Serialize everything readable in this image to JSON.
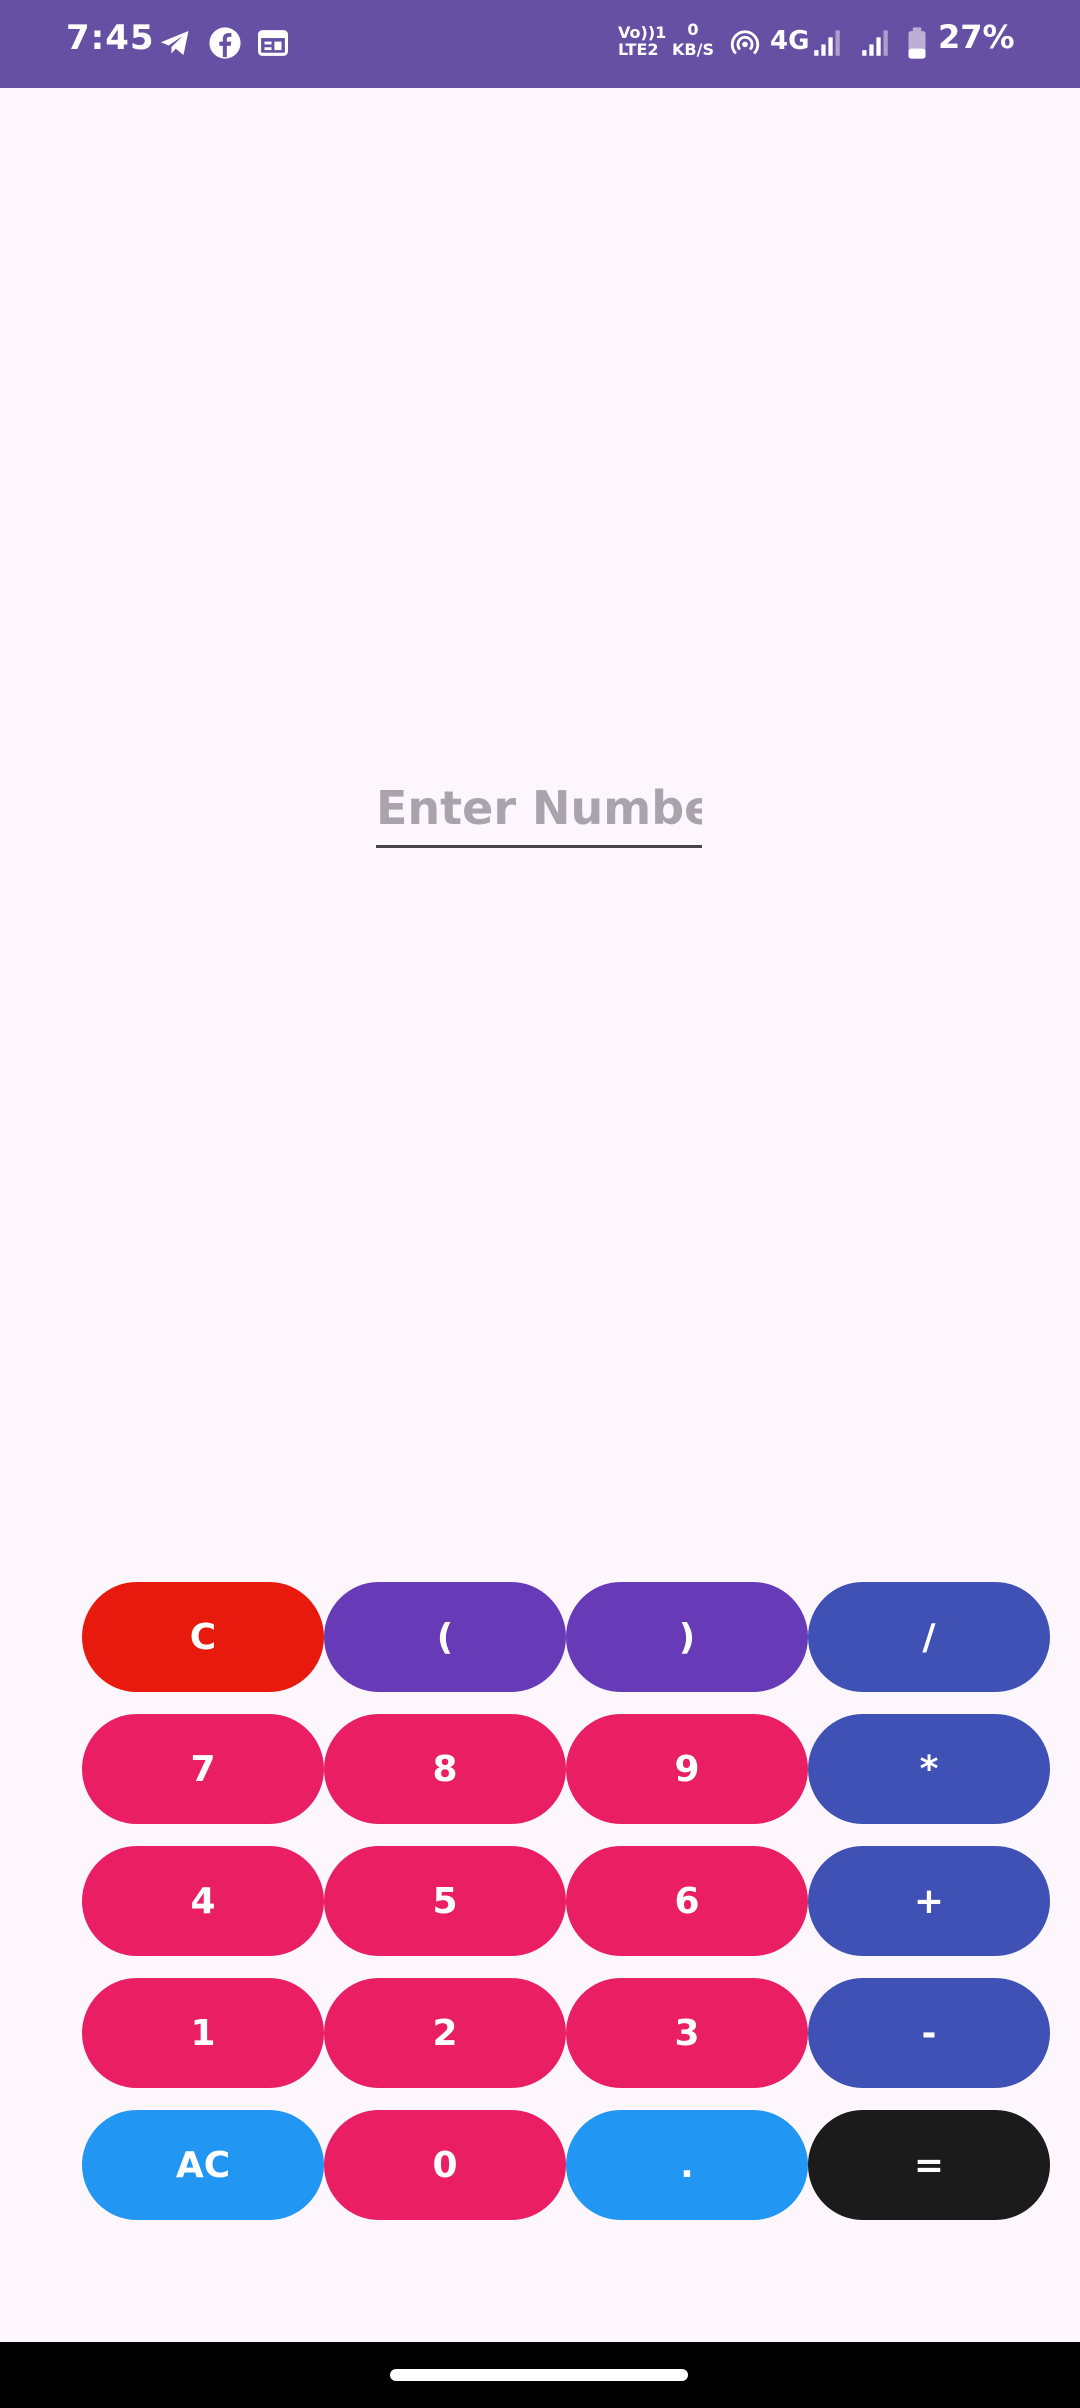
{
  "status_bar": {
    "time": "7:45",
    "volte_line1": "Vo))1",
    "volte_line2": "LTE2",
    "netspeed_value": "0",
    "netspeed_unit": "KB/S",
    "network_type": "4G",
    "battery": "27%",
    "left_icons": [
      "telegram-icon",
      "facebook-icon",
      "calendar-icon"
    ],
    "right_icons": [
      "hotspot-icon",
      "signal-icon",
      "signal-icon",
      "battery-icon"
    ]
  },
  "calculator": {
    "input_value": "",
    "input_placeholder": "Enter Number",
    "keys": [
      {
        "label": "C",
        "name": "clear-button",
        "color": "#E8190D"
      },
      {
        "label": "(",
        "name": "open-paren-button",
        "color": "#673AB7"
      },
      {
        "label": ")",
        "name": "close-paren-button",
        "color": "#673AB7"
      },
      {
        "label": "/",
        "name": "divide-button",
        "color": "#3F51B5"
      },
      {
        "label": "7",
        "name": "digit-7-button",
        "color": "#E91E63"
      },
      {
        "label": "8",
        "name": "digit-8-button",
        "color": "#E91E63"
      },
      {
        "label": "9",
        "name": "digit-9-button",
        "color": "#E91E63"
      },
      {
        "label": "*",
        "name": "multiply-button",
        "color": "#3F51B5"
      },
      {
        "label": "4",
        "name": "digit-4-button",
        "color": "#E91E63"
      },
      {
        "label": "5",
        "name": "digit-5-button",
        "color": "#E91E63"
      },
      {
        "label": "6",
        "name": "digit-6-button",
        "color": "#E91E63"
      },
      {
        "label": "+",
        "name": "add-button",
        "color": "#3F51B5"
      },
      {
        "label": "1",
        "name": "digit-1-button",
        "color": "#E91E63"
      },
      {
        "label": "2",
        "name": "digit-2-button",
        "color": "#E91E63"
      },
      {
        "label": "3",
        "name": "digit-3-button",
        "color": "#E91E63"
      },
      {
        "label": "-",
        "name": "subtract-button",
        "color": "#3F51B5"
      },
      {
        "label": "AC",
        "name": "all-clear-button",
        "color": "#2196F3"
      },
      {
        "label": "0",
        "name": "digit-0-button",
        "color": "#E91E63"
      },
      {
        "label": ".",
        "name": "decimal-button",
        "color": "#2196F3"
      },
      {
        "label": "=",
        "name": "equals-button",
        "color": "#1B1B1B"
      }
    ]
  },
  "colors": {
    "status_bar": "#6650A4",
    "background": "#FDF7FD",
    "nav_bar": "#000000"
  }
}
